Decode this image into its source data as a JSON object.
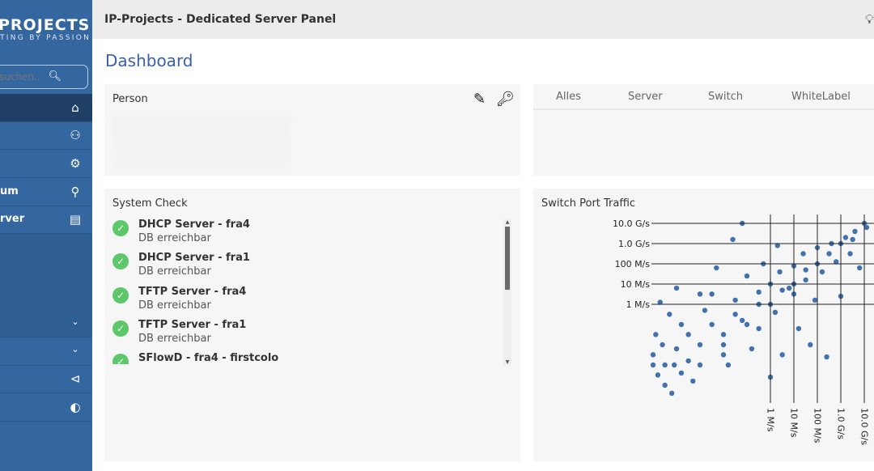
{
  "sidebar": {
    "logo_title": "PROJECTS",
    "logo_tagline": "TING BY PASSION",
    "search_placeholder": "suchen..",
    "items": [
      {
        "label": "",
        "icon": "home-icon",
        "active": true
      },
      {
        "label": "",
        "icon": "users-icon"
      },
      {
        "label": "",
        "icon": "gears-icon"
      },
      {
        "label": "um",
        "icon": "map-marker-icon"
      },
      {
        "label": "rver",
        "icon": "server-terminal-icon"
      },
      {
        "label": "",
        "icon": "chevron-down-icon"
      },
      {
        "label": "",
        "icon": "chevron-down-icon"
      },
      {
        "label": "",
        "icon": "share-nodes-icon"
      },
      {
        "label": "",
        "icon": "gauge-icon"
      }
    ]
  },
  "header": {
    "title": "IP-Projects - Dedicated Server Panel",
    "icon": "lightbulb-icon"
  },
  "page_title": "Dashboard",
  "person": {
    "title": "Person",
    "edit_icon": "pencil-icon",
    "key_icon": "key-icon"
  },
  "tabs": [
    "Alles",
    "Server",
    "Switch",
    "WhiteLabel"
  ],
  "system_check": {
    "title": "System Check",
    "items": [
      {
        "name": "DHCP Server - fra4",
        "status": "DB erreichbar"
      },
      {
        "name": "DHCP Server - fra1",
        "status": "DB erreichbar"
      },
      {
        "name": "TFTP Server - fra4",
        "status": "DB erreichbar"
      },
      {
        "name": "TFTP Server - fra1",
        "status": "DB erreichbar"
      },
      {
        "name": "SFlowD - fra4 - firstcolo",
        "status": ""
      }
    ],
    "ok_color": "#5cc86a"
  },
  "chart_data": {
    "type": "scatter",
    "title": "Switch Port Traffic",
    "x_scale": "log",
    "y_scale": "log",
    "x_ticks": [
      {
        "v": 1,
        "label": "1 M/s"
      },
      {
        "v": 10,
        "label": "10 M/s"
      },
      {
        "v": 100,
        "label": "100 M/s"
      },
      {
        "v": 1000,
        "label": "1.0 G/s"
      },
      {
        "v": 10000,
        "label": "10.0 G/s"
      }
    ],
    "y_ticks": [
      {
        "v": 10000,
        "label": "10.0 G/s"
      },
      {
        "v": 1000,
        "label": "1.0 G/s"
      },
      {
        "v": 100,
        "label": "100 M/s"
      },
      {
        "v": 10,
        "label": "10 M/s"
      },
      {
        "v": 1,
        "label": "1 M/s"
      }
    ],
    "grid": true,
    "color": "#4272ae",
    "points": [
      [
        1e-05,
        0.0032
      ],
      [
        1e-05,
        0.001
      ],
      [
        1.6e-05,
        0.00032
      ],
      [
        3.2e-05,
        0.0001
      ],
      [
        6.3e-05,
        4e-05
      ],
      [
        2.5e-05,
        0.01
      ],
      [
        1.3e-05,
        0.032
      ],
      [
        5e-05,
        0.32
      ],
      [
        0.0001,
        6.3
      ],
      [
        0.00016,
        0.1
      ],
      [
        0.00032,
        0.0016
      ],
      [
        0.0005,
        0.00016
      ],
      [
        0.001,
        0.01
      ],
      [
        0.0016,
        0.5
      ],
      [
        0.0032,
        3.2
      ],
      [
        0.005,
        63
      ],
      [
        0.01,
        0.032
      ],
      [
        0.016,
        0.001
      ],
      [
        0.032,
        1.6
      ],
      [
        0.063,
        0.16
      ],
      [
        0.1,
        25
      ],
      [
        0.16,
        0.0063
      ],
      [
        0.32,
        4
      ],
      [
        0.5,
        100
      ],
      [
        1,
        0.00025
      ],
      [
        1,
        10
      ],
      [
        1.6,
        0.4
      ],
      [
        2.5,
        40
      ],
      [
        3.2,
        0.0032
      ],
      [
        6.3,
        6.3
      ],
      [
        10,
        79
      ],
      [
        16,
        0.063
      ],
      [
        25,
        316
      ],
      [
        32,
        16
      ],
      [
        50,
        0.01
      ],
      [
        79,
        1.6
      ],
      [
        100,
        630
      ],
      [
        160,
        40
      ],
      [
        250,
        0.0025
      ],
      [
        400,
        1000
      ],
      [
        630,
        126
      ],
      [
        1000,
        2.5
      ],
      [
        1600,
        2000
      ],
      [
        2500,
        316
      ],
      [
        4000,
        4000
      ],
      [
        6300,
        63
      ],
      [
        10000,
        10000
      ],
      [
        12600,
        6300
      ],
      [
        0.063,
        10000
      ],
      [
        8e-05,
        0.001
      ],
      [
        0.00016,
        0.0004
      ],
      [
        0.01,
        0.0032
      ],
      [
        0.32,
        0.063
      ],
      [
        10,
        3.2
      ],
      [
        0.001,
        3.2
      ],
      [
        2e-05,
        1.26
      ],
      [
        2,
        800
      ],
      [
        0.025,
        1600
      ],
      [
        0.0001,
        0.0063
      ],
      [
        0.00032,
        0.032
      ],
      [
        0.0032,
        0.1
      ],
      [
        0.032,
        0.32
      ],
      [
        0.32,
        1
      ],
      [
        3.2,
        5
      ],
      [
        32,
        50
      ],
      [
        316,
        316
      ],
      [
        3200,
        1600
      ],
      [
        3.2e-05,
        0.001
      ],
      [
        0.001,
        0.001
      ],
      [
        0.01,
        0.01
      ],
      [
        0.1,
        0.1
      ],
      [
        1,
        1
      ],
      [
        10,
        10
      ],
      [
        100,
        100
      ],
      [
        1000,
        1000
      ]
    ]
  }
}
